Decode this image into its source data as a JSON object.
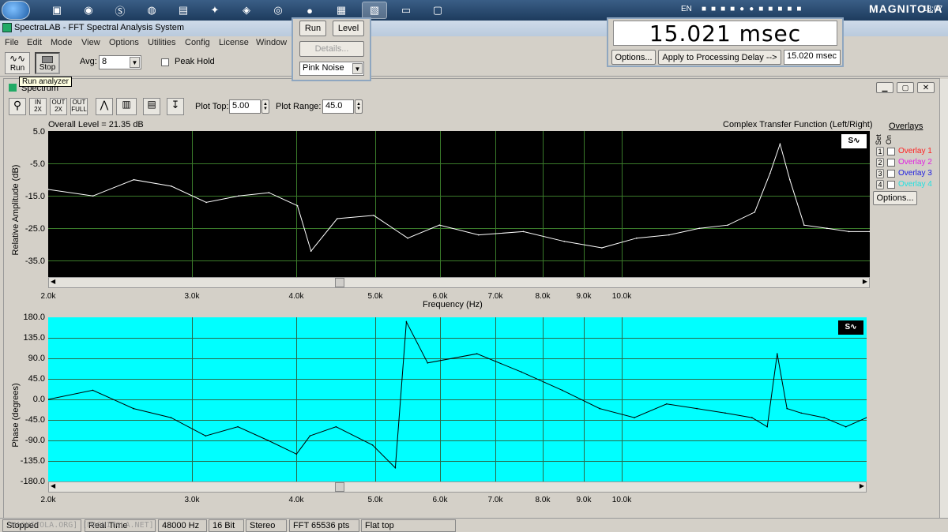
{
  "taskbar": {
    "lang": "EN",
    "clock": "18:07",
    "brand": "MAGNITOLA"
  },
  "window": {
    "title": "SpectraLAB - FFT Spectral Analysis System"
  },
  "menu": [
    "File",
    "Edit",
    "Mode",
    "View",
    "Options",
    "Utilities",
    "Config",
    "License",
    "Window"
  ],
  "toolbar": {
    "run_label": "Run",
    "stop_label": "Stop",
    "avg_label": "Avg:",
    "avg_value": "8",
    "peak_hold_label": "Peak Hold",
    "tooltip": "Run analyzer"
  },
  "generator": {
    "run_label": "Run",
    "level_label": "Level",
    "details_label": "Details...",
    "signal": "Pink Noise"
  },
  "delay": {
    "readout": "15.021 msec",
    "options_label": "Options...",
    "apply_label": "Apply to Processing Delay -->",
    "apply_value": "15.020 msec"
  },
  "spectrum": {
    "title": "Spectrum",
    "plot_top_label": "Plot Top:",
    "plot_top_value": "5.00",
    "plot_range_label": "Plot Range:",
    "plot_range_value": "45.0",
    "overall_level": "Overall Level = 21.35 dB",
    "function_label": "Complex Transfer Function (Left/Right)",
    "overlays_title": "Overlays",
    "overlay_set": "Set",
    "overlay_on": "On",
    "overlays": [
      {
        "num": "1",
        "label": "Overlay 1",
        "color": "#ff2020"
      },
      {
        "num": "2",
        "label": "Overlay 2",
        "color": "#e020e0"
      },
      {
        "num": "3",
        "label": "Overlay 3",
        "color": "#2020e0"
      },
      {
        "num": "4",
        "label": "Overlay 4",
        "color": "#20e0e0"
      }
    ],
    "options_label": "Options...",
    "freq_label": "Frequency (Hz)",
    "amp_ylabel": "Relative Amplitude (dB)",
    "phase_ylabel": "Phase (degrees)",
    "amp_yticks": [
      "5.0",
      "-5.0",
      "-15.0",
      "-25.0",
      "-35.0"
    ],
    "phase_yticks": [
      "180.0",
      "135.0",
      "90.0",
      "45.0",
      "0.0",
      "-45.0",
      "-90.0",
      "-135.0",
      "-180.0"
    ],
    "xticks": [
      "2.0k",
      "3.0k",
      "4.0k",
      "5.0k",
      "6.0k",
      "7.0k",
      "8.0k",
      "9.0k",
      "10.0k"
    ]
  },
  "chart_data": [
    {
      "type": "line",
      "title": "",
      "xlabel": "Frequency (Hz)",
      "ylabel": "Relative Amplitude (dB)",
      "ylim": [
        -40,
        5
      ],
      "xlim": [
        2000,
        11500
      ],
      "xscale": "log",
      "grid": true,
      "background": "#000000",
      "line_color": "#ffffff",
      "x": [
        2000,
        2200,
        2400,
        2600,
        2800,
        3000,
        3200,
        3400,
        3500,
        3700,
        4000,
        4300,
        4600,
        5000,
        5500,
        6000,
        6500,
        7000,
        7500,
        8000,
        8500,
        9000,
        9300,
        9500,
        9700,
        10000,
        10500,
        11000,
        11500
      ],
      "y": [
        -13,
        -15,
        -10,
        -12,
        -17,
        -15,
        -14,
        -18,
        -32,
        -22,
        -21,
        -28,
        -24,
        -27,
        -26,
        -29,
        -31,
        -28,
        -27,
        -25,
        -24,
        -20,
        -8,
        1,
        -10,
        -24,
        -25,
        -26,
        -26
      ]
    },
    {
      "type": "line",
      "title": "",
      "xlabel": "Frequency (Hz)",
      "ylabel": "Phase (degrees)",
      "ylim": [
        -180,
        180
      ],
      "xlim": [
        2000,
        11500
      ],
      "xscale": "log",
      "grid": true,
      "background": "#00ffff",
      "line_color": "#000000",
      "x": [
        2000,
        2200,
        2400,
        2600,
        2800,
        3000,
        3200,
        3400,
        3500,
        3700,
        4000,
        4200,
        4300,
        4500,
        5000,
        5500,
        6000,
        6500,
        7000,
        7500,
        8000,
        8500,
        9000,
        9300,
        9500,
        9700,
        10000,
        10500,
        11000,
        11500
      ],
      "y": [
        0,
        20,
        -20,
        -40,
        -80,
        -60,
        -90,
        -120,
        -80,
        -60,
        -100,
        -150,
        170,
        80,
        100,
        60,
        20,
        -20,
        -40,
        -10,
        -20,
        -30,
        -40,
        -60,
        100,
        -20,
        -30,
        -40,
        -60,
        -40
      ]
    }
  ],
  "status": {
    "state": "Stopped",
    "mode": "Real Time",
    "rate": "48000 Hz",
    "bits": "16 Bit",
    "channels": "Stereo",
    "fft": "FFT 65536 pts",
    "window": "Flat top",
    "watermark": "[MAGNITOLA.ORG] [MAGNITOLA.NET]"
  }
}
